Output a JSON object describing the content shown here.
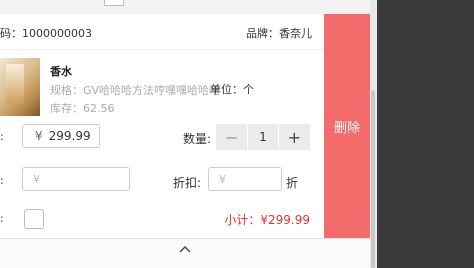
{
  "header": {
    "code_text": "码：1000000003",
    "brand_text": "品牌：香奈儿"
  },
  "product": {
    "name": "香水",
    "spec": "规格：GV哈哈哈方法哼嘿嘿哈哈哈",
    "unit": "单位：个",
    "stock": "库存：62.56"
  },
  "price": {
    "label_colon": ":",
    "currency": "¥",
    "value": "299.99"
  },
  "quantity": {
    "label": "数量:",
    "minus": "−",
    "value": "1",
    "plus": "+"
  },
  "discount": {
    "label_colon": ":",
    "amount_placeholder": "¥",
    "label": "折扣:",
    "rate_placeholder": "¥",
    "suffix": "折"
  },
  "gift": {
    "label_colon": ":"
  },
  "subtotal": "小计：¥299.99",
  "delete_label": "删除"
}
